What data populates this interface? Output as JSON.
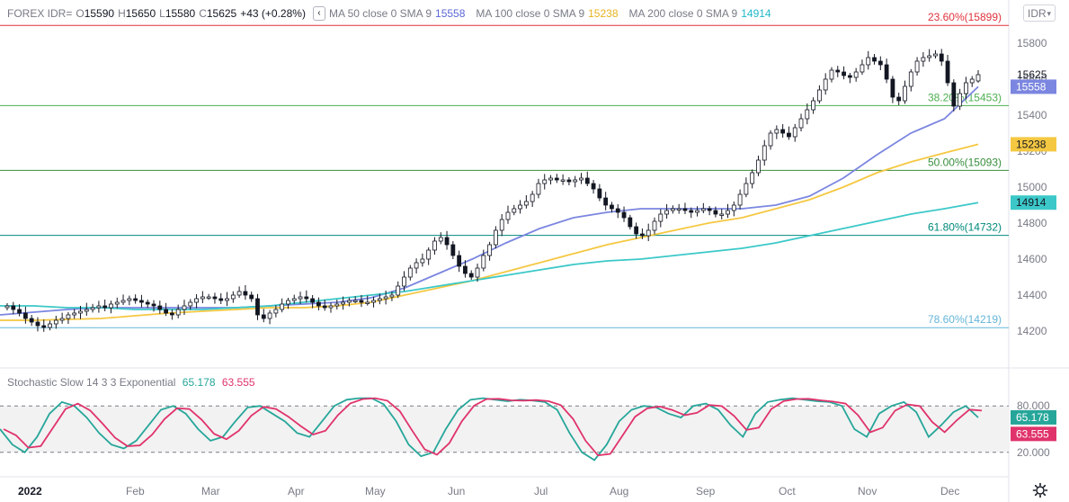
{
  "header": {
    "symbol": "FOREX IDR=",
    "open_label": "O",
    "open": "15590",
    "high_label": "H",
    "high": "15650",
    "low_label": "L",
    "low": "15580",
    "close_label": "C",
    "close": "15625",
    "change": "+43 (+0.28%)",
    "hide_icon": "chevron-left-icon",
    "ma1": {
      "label": "MA 50 close 0 SMA 9",
      "value": "15558",
      "color": "#7b86e0"
    },
    "ma2": {
      "label": "MA 100 close 0 SMA 9",
      "value": "15238",
      "color": "#f5c842"
    },
    "ma3": {
      "label": "MA 200 close 0 SMA 9",
      "value": "14914",
      "color": "#3cc8c8"
    },
    "currency_select": "IDR",
    "currency_caret": "▾"
  },
  "stochastic": {
    "label": "Stochastic Slow 14 3 3 Exponential",
    "k_value": "65.178",
    "k_color": "#26a69a",
    "d_value": "63.555",
    "d_color": "#e0336b",
    "upper_band": "80.000",
    "lower_band": "20.000"
  },
  "chart_data": {
    "type": "candlestick",
    "xlabel": "",
    "ylabel": "",
    "x_ticks": [
      "2022",
      "Feb",
      "Mar",
      "Apr",
      "May",
      "Jun",
      "Jul",
      "Aug",
      "Sep",
      "Oct",
      "Nov",
      "Dec"
    ],
    "y_ticks": [
      15800,
      15600,
      15400,
      15200,
      15000,
      14800,
      14600,
      14400,
      14200
    ],
    "ylim": [
      14100,
      15950
    ],
    "last_price": 15625,
    "last_candle": {
      "open": 15590,
      "high": 15650,
      "low": 15580,
      "close": 15625
    },
    "fib_levels": [
      {
        "label": "23.60%(15899)",
        "value": 15899,
        "color": "#e0323c"
      },
      {
        "label": "38.20%(15453)",
        "value": 15453,
        "color": "#4caf50"
      },
      {
        "label": "50.00%(15093)",
        "value": 15093,
        "color": "#388e3c"
      },
      {
        "label": "61.80%(14732)",
        "value": 14732,
        "color": "#00897b"
      },
      {
        "label": "78.60%(14219)",
        "value": 14219,
        "color": "#64b5d9"
      }
    ],
    "closes": [
      14340,
      14320,
      14300,
      14270,
      14250,
      14230,
      14220,
      14240,
      14260,
      14270,
      14290,
      14300,
      14310,
      14320,
      14330,
      14340,
      14330,
      14350,
      14360,
      14370,
      14380,
      14370,
      14360,
      14350,
      14340,
      14320,
      14300,
      14290,
      14320,
      14340,
      14360,
      14380,
      14390,
      14390,
      14380,
      14370,
      14380,
      14400,
      14420,
      14400,
      14380,
      14290,
      14270,
      14300,
      14320,
      14350,
      14370,
      14380,
      14390,
      14380,
      14360,
      14340,
      14330,
      14340,
      14350,
      14360,
      14370,
      14370,
      14360,
      14360,
      14370,
      14380,
      14390,
      14400,
      14450,
      14500,
      14550,
      14580,
      14600,
      14650,
      14700,
      14720,
      14680,
      14620,
      14560,
      14520,
      14500,
      14550,
      14620,
      14680,
      14760,
      14820,
      14860,
      14880,
      14900,
      14920,
      14960,
      15020,
      15040,
      15050,
      15040,
      15040,
      15030,
      15040,
      15050,
      15020,
      14990,
      14940,
      14900,
      14880,
      14860,
      14830,
      14780,
      14740,
      14730,
      14760,
      14810,
      14850,
      14870,
      14880,
      14880,
      14870,
      14860,
      14870,
      14880,
      14870,
      14850,
      14850,
      14870,
      14900,
      14960,
      15020,
      15080,
      15150,
      15230,
      15300,
      15320,
      15300,
      15280,
      15330,
      15380,
      15430,
      15480,
      15540,
      15600,
      15650,
      15640,
      15620,
      15610,
      15640,
      15680,
      15720,
      15700,
      15680,
      15600,
      15500,
      15480,
      15560,
      15640,
      15700,
      15720,
      15730,
      15740,
      15700,
      15580,
      15450,
      15520,
      15580,
      15600,
      15625
    ],
    "series": [
      {
        "name": "MA 50 close 0 SMA 9",
        "last": 15558,
        "color": "#7b86e0",
        "values": [
          14290,
          14305,
          14320,
          14330,
          14330,
          14330,
          14330,
          14330,
          14340,
          14350,
          14360,
          14385,
          14440,
          14520,
          14600,
          14690,
          14770,
          14830,
          14860,
          14880,
          14880,
          14880,
          14880,
          14900,
          14950,
          15050,
          15180,
          15300,
          15380,
          15558
        ]
      },
      {
        "name": "MA 100 close 0 SMA 9",
        "last": 15238,
        "color": "#f5c842",
        "values": [
          14260,
          14260,
          14265,
          14270,
          14285,
          14300,
          14310,
          14320,
          14330,
          14330,
          14340,
          14360,
          14400,
          14440,
          14480,
          14530,
          14580,
          14630,
          14680,
          14720,
          14760,
          14800,
          14830,
          14880,
          14930,
          15000,
          15080,
          15140,
          15190,
          15238
        ]
      },
      {
        "name": "MA 200 close 0 SMA 9",
        "last": 14914,
        "color": "#3cc8c8",
        "values": [
          14340,
          14340,
          14330,
          14330,
          14320,
          14320,
          14320,
          14330,
          14340,
          14360,
          14380,
          14400,
          14420,
          14450,
          14480,
          14510,
          14540,
          14570,
          14590,
          14600,
          14620,
          14640,
          14660,
          14690,
          14730,
          14770,
          14810,
          14850,
          14880,
          14914
        ]
      }
    ],
    "stoch_k": [
      50,
      30,
      20,
      40,
      70,
      85,
      80,
      65,
      45,
      30,
      25,
      35,
      55,
      75,
      80,
      70,
      50,
      35,
      40,
      60,
      78,
      80,
      70,
      60,
      45,
      40,
      60,
      80,
      88,
      90,
      90,
      82,
      60,
      30,
      15,
      20,
      50,
      75,
      88,
      90,
      88,
      86,
      88,
      87,
      85,
      75,
      45,
      20,
      10,
      30,
      60,
      75,
      80,
      78,
      70,
      65,
      80,
      83,
      75,
      55,
      40,
      70,
      85,
      88,
      90,
      88,
      86,
      85,
      80,
      50,
      40,
      70,
      80,
      85,
      72,
      40,
      55,
      72,
      80,
      65
    ]
  }
}
